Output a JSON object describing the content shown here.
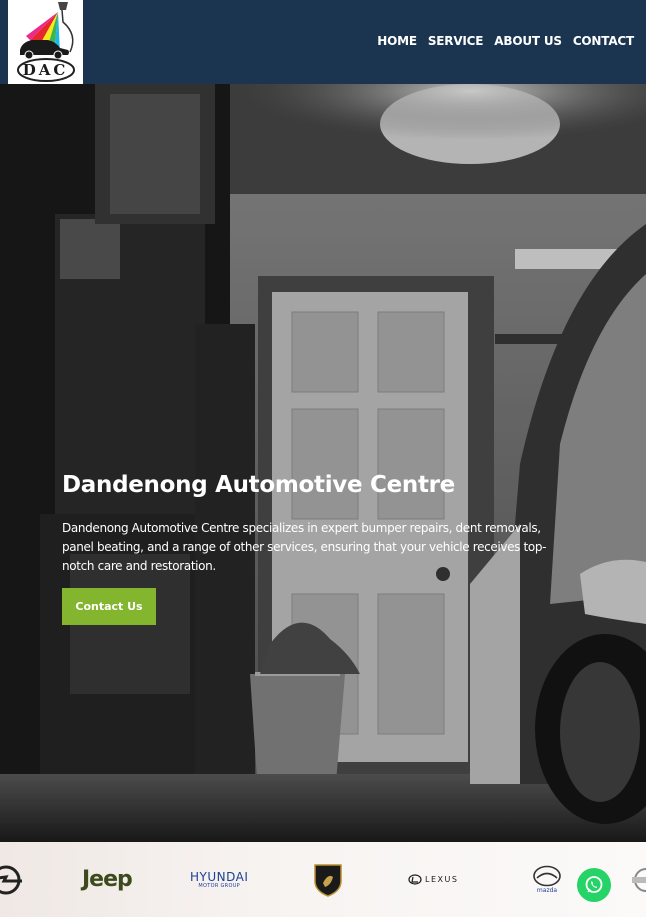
{
  "header": {
    "logo_text": "DAC",
    "nav": [
      {
        "label": "HOME"
      },
      {
        "label": "SERVICE"
      },
      {
        "label": "ABOUT US"
      },
      {
        "label": "CONTACT"
      }
    ]
  },
  "hero": {
    "title": "Dandenong Automotive Centre",
    "description": "Dandenong Automotive Centre specializes in expert bumper repairs, dent removals, panel beating, and a range of other services, ensuring that your vehicle receives top-notch care and restoration.",
    "cta_label": "Contact Us"
  },
  "brands": {
    "items": [
      {
        "name": "Opel",
        "icon": "opel-logo-icon"
      },
      {
        "name": "Jeep",
        "text": "Jeep"
      },
      {
        "name": "Hyundai",
        "text": "HYUNDAI",
        "subtext": "MOTOR GROUP"
      },
      {
        "name": "Lamborghini",
        "icon": "lamborghini-logo-icon"
      },
      {
        "name": "Lexus",
        "text": "LEXUS"
      },
      {
        "name": "Mazda",
        "text": "mazda"
      },
      {
        "name": "Nissan",
        "icon": "nissan-logo-icon"
      }
    ]
  },
  "colors": {
    "header_bg": "#1b3550",
    "cta_green": "#84b52f",
    "whatsapp_green": "#25d366",
    "jeep_green": "#3d4a1d",
    "hyundai_blue": "#1c3f94"
  }
}
